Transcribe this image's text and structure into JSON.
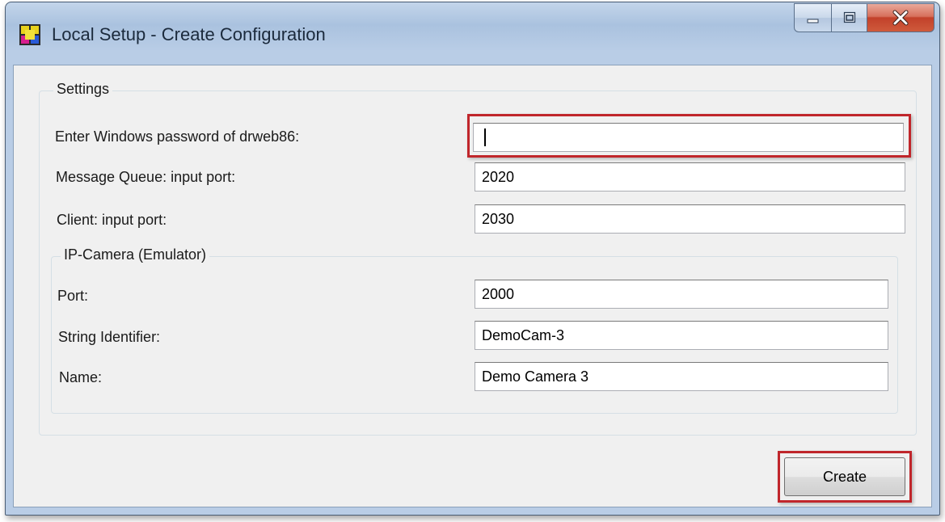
{
  "window": {
    "title": "Local Setup - Create Configuration",
    "caption_buttons": [
      "minimize",
      "maximize",
      "close"
    ]
  },
  "settings": {
    "legend": "Settings",
    "password": {
      "label": "Enter Windows password of drweb86:",
      "value": ""
    },
    "mq_port": {
      "label": "Message Queue: input port:",
      "value": "2020"
    },
    "client_port": {
      "label": "Client: input port:",
      "value": "2030"
    }
  },
  "camera": {
    "legend": "IP-Camera (Emulator)",
    "port": {
      "label": "Port:",
      "value": "2000"
    },
    "string_id": {
      "label": "String Identifier:",
      "value": "DemoCam-3"
    },
    "name": {
      "label": "Name:",
      "value": "Demo Camera 3"
    }
  },
  "actions": {
    "create_label": "Create"
  },
  "colors": {
    "highlight": "#c0262b",
    "close_button": "#c2412a",
    "frame": "#b9cde6"
  }
}
